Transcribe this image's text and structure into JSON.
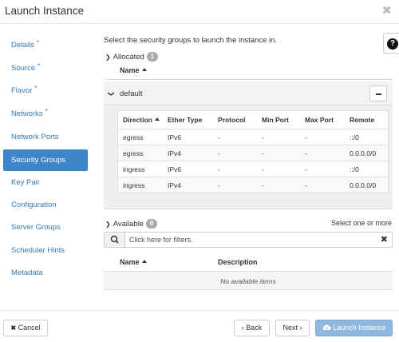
{
  "window": {
    "title": "Launch Instance",
    "close_glyph": "✖"
  },
  "help": {
    "glyph": "?",
    "icon": "question-circle-icon"
  },
  "sidebar": {
    "items": [
      {
        "label": "Details",
        "required": "*"
      },
      {
        "label": "Source",
        "required": "*"
      },
      {
        "label": "Flavor",
        "required": "*"
      },
      {
        "label": "Networks",
        "required": "*"
      },
      {
        "label": "Network Ports",
        "required": ""
      },
      {
        "label": "Security Groups",
        "required": ""
      },
      {
        "label": "Key Pair",
        "required": ""
      },
      {
        "label": "Configuration",
        "required": ""
      },
      {
        "label": "Server Groups",
        "required": ""
      },
      {
        "label": "Scheduler Hints",
        "required": ""
      },
      {
        "label": "Metadata",
        "required": ""
      }
    ],
    "active_index": 5
  },
  "main": {
    "intro": "Select the security groups to launch the instance in.",
    "allocated": {
      "label": "Allocated",
      "count": "1",
      "name_header": "Name",
      "group_name": "default",
      "rules": {
        "headers": [
          "Direction",
          "Ether Type",
          "Protocol",
          "Min Port",
          "Max Port",
          "Remote"
        ],
        "rows": [
          [
            "egress",
            "IPv6",
            "-",
            "-",
            "-",
            "::/0"
          ],
          [
            "egress",
            "IPv4",
            "-",
            "-",
            "-",
            "0.0.0.0/0"
          ],
          [
            "ingress",
            "IPv6",
            "-",
            "-",
            "-",
            "::/0"
          ],
          [
            "ingress",
            "IPv4",
            "-",
            "-",
            "-",
            "0.0.0.0/0"
          ]
        ]
      }
    },
    "available": {
      "label": "Available",
      "count": "0",
      "hint": "Select one or more",
      "filter_placeholder": "Click here for filters.",
      "name_header": "Name",
      "description_header": "Description",
      "empty_text": "No available items"
    }
  },
  "footer": {
    "cancel": "Cancel",
    "back": "Back",
    "next": "Next",
    "launch": "Launch Instance"
  },
  "colors": {
    "accent": "#3f86c8",
    "link": "#337ab7",
    "primary_disabled": "#8fb8df"
  }
}
